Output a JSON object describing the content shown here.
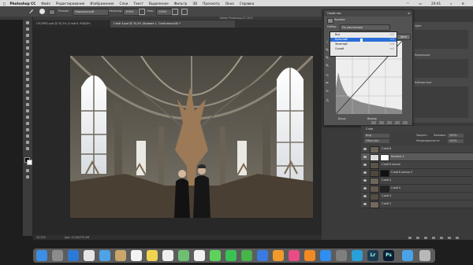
{
  "menubar": {
    "app": "Photoshop CC",
    "items": [
      "Файл",
      "Редактирование",
      "Изображение",
      "Слои",
      "Текст",
      "Выделение",
      "Фильтр",
      "3D",
      "Просмотр",
      "Окно",
      "Справка"
    ],
    "clock": "20:41"
  },
  "optionsbar": {
    "mode_label": "Режим:",
    "mode_value": "Нормальный",
    "opacity_label": "Непрозр.:",
    "opacity_value": "100%",
    "flow_label": "Наж.:",
    "flow_value": "100%"
  },
  "window_title": "Adobe Photoshop CC 2017",
  "doc_tabs": [
    {
      "label": "ГУСАРЕ2.psd @ 33,3% (Слой 6, RGB/8*)"
    },
    {
      "label": "Слой 3.psd @ 33,3% (Кривые 1, Слой-маска/8) *"
    }
  ],
  "statusbar": {
    "zoom": "33,33%",
    "doc": "Док: 43,2М/379,9М"
  },
  "properties": {
    "title": "Свойства",
    "subtitle": "Кривые",
    "preset_label": "Набор:",
    "preset_value": "По умолчанию",
    "preset_options": [
      {
        "label": "Все",
        "shortcut": "⌥2",
        "selected": false
      },
      {
        "label": "Красный",
        "shortcut": "⌥3",
        "selected": true
      },
      {
        "label": "Зеленый",
        "shortcut": "⌥4",
        "selected": false
      },
      {
        "label": "Синий",
        "shortcut": "⌥5",
        "selected": false
      }
    ],
    "auto_label": "Авто",
    "input_label": "Вход:",
    "output_label": "Выход:"
  },
  "adjust_panel": {
    "labels": [
      "Цвет",
      "Коррекция",
      "Библиотеки"
    ]
  },
  "layers": {
    "tab": "Слои",
    "kind_label": "Вид",
    "blend_mode": "Обычные",
    "opacity_label": "Непрозрачность:",
    "opacity_value": "100%",
    "lock_label": "Закреп.:",
    "fill_label": "Заливка:",
    "fill_value": "100%",
    "rows": [
      {
        "name": "Слой 8",
        "selected": false,
        "thumb": "#6a6258",
        "has_mask": false
      },
      {
        "name": "Кривые 1",
        "selected": true,
        "thumb": "#dcdcdc",
        "has_mask": true
      },
      {
        "name": "Слой 6 копия",
        "selected": false,
        "thumb": "#5a5348",
        "has_mask": false
      },
      {
        "name": "Слой 6 копия 3",
        "selected": false,
        "thumb": "#4e473d",
        "has_mask": true
      },
      {
        "name": "Слой 4",
        "selected": false,
        "thumb": "#6d665a",
        "has_mask": false
      },
      {
        "name": "Слой 5",
        "selected": false,
        "thumb": "#625a4e",
        "has_mask": true
      },
      {
        "name": "Слой 3",
        "selected": false,
        "thumb": "#554e44",
        "has_mask": false
      },
      {
        "name": "Слой 1",
        "selected": false,
        "thumb": "#736a5d",
        "has_mask": false
      }
    ]
  },
  "dock": {
    "apps": [
      {
        "name": "finder",
        "color": "#3d8ee6"
      },
      {
        "name": "launchpad",
        "color": "#8c8c8c"
      },
      {
        "name": "safari",
        "color": "#2d7ad6"
      },
      {
        "name": "chrome",
        "color": "#e5e5e5"
      },
      {
        "name": "mail",
        "color": "#4ea2e8"
      },
      {
        "name": "contacts",
        "color": "#caa66a"
      },
      {
        "name": "calendar",
        "color": "#f3f3f3"
      },
      {
        "name": "notes",
        "color": "#f0d34e"
      },
      {
        "name": "reminders",
        "color": "#efefef"
      },
      {
        "name": "maps",
        "color": "#6fbf73"
      },
      {
        "name": "photos",
        "color": "#f1f1f1"
      },
      {
        "name": "messages",
        "color": "#5ed35c"
      },
      {
        "name": "facetime",
        "color": "#39c155"
      },
      {
        "name": "numbers",
        "color": "#48b24b"
      },
      {
        "name": "keynote",
        "color": "#3b7be0"
      },
      {
        "name": "pages",
        "color": "#f09a2a"
      },
      {
        "name": "itunes",
        "color": "#e84b86"
      },
      {
        "name": "ibooks",
        "color": "#f08a24"
      },
      {
        "name": "app-store",
        "color": "#2f8ef0"
      },
      {
        "name": "preferences",
        "color": "#7f7f7f"
      },
      {
        "name": "telegram",
        "color": "#2aa0d8"
      },
      {
        "name": "lightroom",
        "color": "#1b3a52",
        "text": "Lr"
      },
      {
        "name": "photoshop",
        "color": "#0a1d33",
        "text": "Ps"
      },
      {
        "name": "downloads",
        "color": "#4aa3e8"
      },
      {
        "name": "trash",
        "color": "#b8b8b8"
      }
    ]
  }
}
